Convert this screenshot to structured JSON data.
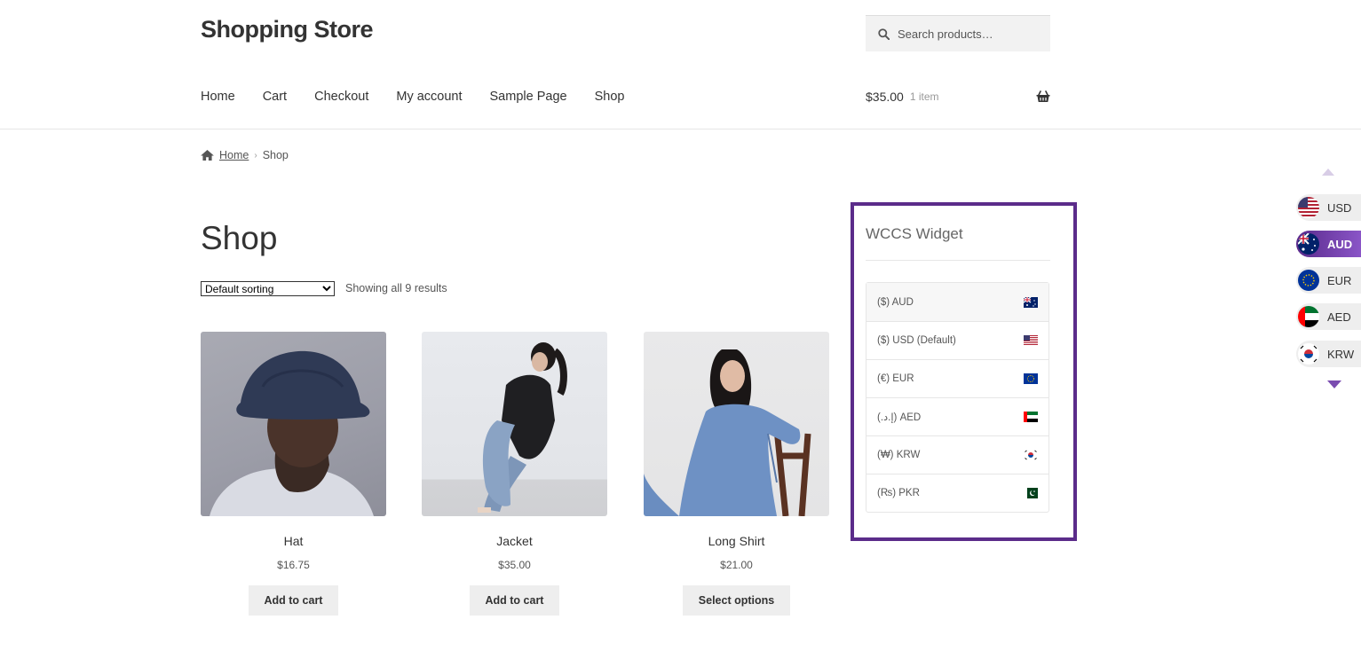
{
  "header": {
    "site_title": "Shopping Store",
    "search_placeholder": "Search products…",
    "nav": [
      "Home",
      "Cart",
      "Checkout",
      "My account",
      "Sample Page",
      "Shop"
    ],
    "cart_amount": "$35.00",
    "cart_count": "1 item"
  },
  "breadcrumb": {
    "home": "Home",
    "current": "Shop"
  },
  "shop": {
    "title": "Shop",
    "sorting_selected": "Default sorting",
    "results_text": "Showing all 9 results",
    "products": [
      {
        "name": "Hat",
        "price": "$16.75",
        "button": "Add to cart"
      },
      {
        "name": "Jacket",
        "price": "$35.00",
        "button": "Add to cart"
      },
      {
        "name": "Long Shirt",
        "price": "$21.00",
        "button": "Select options"
      }
    ]
  },
  "widget": {
    "title": "WCCS Widget",
    "currencies": [
      {
        "symbol": "($)",
        "code": "AUD",
        "flag": "au-flag-icon"
      },
      {
        "symbol": "($)",
        "code": "USD (Default)",
        "flag": "us-flag-icon"
      },
      {
        "symbol": "(€)",
        "code": "EUR",
        "flag": "eu-flag-icon"
      },
      {
        "symbol": "(.إ.د)",
        "code": "AED",
        "flag": "ae-flag-icon"
      },
      {
        "symbol": "(₩)",
        "code": "KRW",
        "flag": "kr-flag-icon"
      },
      {
        "symbol": "(₨)",
        "code": "PKR",
        "flag": "pk-flag-icon"
      }
    ]
  },
  "switcher": {
    "items": [
      {
        "code": "USD",
        "flag": "us-flag-icon"
      },
      {
        "code": "AUD",
        "flag": "au-flag-icon",
        "active": true
      },
      {
        "code": "EUR",
        "flag": "eu-flag-icon"
      },
      {
        "code": "AED",
        "flag": "ae-flag-icon"
      },
      {
        "code": "KRW",
        "flag": "kr-flag-icon"
      }
    ]
  },
  "colors": {
    "accent": "#5b2c8a",
    "button_bg": "#eeeeee",
    "text": "#333333"
  }
}
